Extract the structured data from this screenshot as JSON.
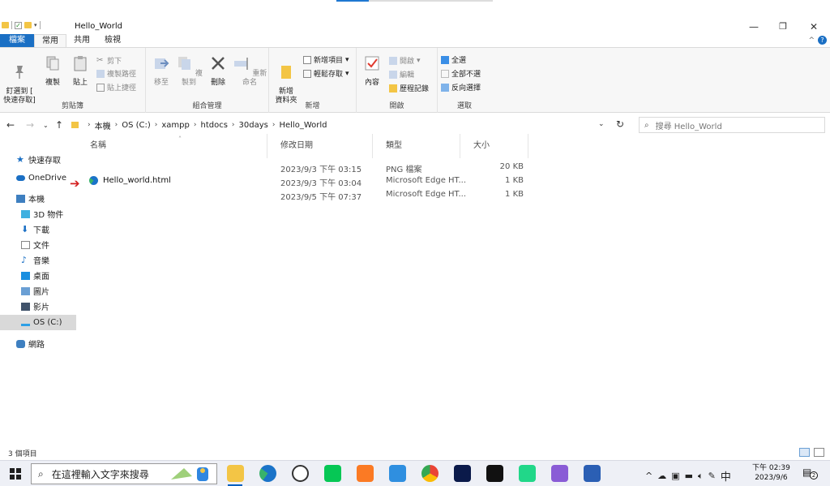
{
  "window": {
    "title": "Hello_World"
  },
  "ribbon_tabs": [
    "檔案",
    "常用",
    "共用",
    "檢視"
  ],
  "ribbon": {
    "clipboard": {
      "pin": "釘選到 [\n快速存取]",
      "copy": "複製",
      "paste": "貼上",
      "cut": "剪下",
      "copy_path": "複製路徑",
      "paste_shortcut": "貼上捷徑",
      "label": "剪貼簿"
    },
    "organize": {
      "move_to": "移至",
      "copy_to": "複製到",
      "delete": "刪除",
      "rename": "重新命名",
      "label": "組合管理"
    },
    "new": {
      "new_folder": "新增\n資料夾",
      "new_item": "新增項目",
      "easy_access": "輕鬆存取",
      "label": "新增"
    },
    "open": {
      "properties": "內容",
      "open": "開啟",
      "edit": "編輯",
      "history": "歷程記錄",
      "label": "開啟"
    },
    "select": {
      "select_all": "全選",
      "select_none": "全部不選",
      "invert": "反向選擇",
      "label": "選取"
    }
  },
  "address": {
    "crumbs": [
      "本機",
      "OS (C:)",
      "xampp",
      "htdocs",
      "30days",
      "Hello_World"
    ],
    "search_placeholder": "搜尋 Hello_World"
  },
  "nav_pane": {
    "quick_access": "快速存取",
    "onedrive": "OneDrive",
    "this_pc": "本機",
    "items": [
      "3D 物件",
      "下載",
      "文件",
      "音樂",
      "桌面",
      "圖片",
      "影片",
      "OS (C:)"
    ],
    "network": "網路"
  },
  "columns": {
    "name": "名稱",
    "modified": "修改日期",
    "type": "類型",
    "size": "大小"
  },
  "files": [
    {
      "name": "",
      "modified": "2023/9/3 下午 03:15",
      "type": "PNG 檔案",
      "size": "20 KB"
    },
    {
      "name": "Hello_world.html",
      "modified": "2023/9/3 下午 03:04",
      "type": "Microsoft Edge HT...",
      "size": "1 KB"
    },
    {
      "name": "",
      "modified": "2023/9/5 下午 07:37",
      "type": "Microsoft Edge HT...",
      "size": "1 KB"
    }
  ],
  "status": {
    "item_count": "3 個項目"
  },
  "taskbar": {
    "search_placeholder": "在這裡輸入文字來搜尋",
    "ime": "中",
    "time": "下午 02:39",
    "date": "2023/9/6",
    "notifications": "2"
  },
  "colors": {
    "accent": "#1a6fc4",
    "folder": "#f3c545",
    "selection": "#d9d9d9"
  }
}
